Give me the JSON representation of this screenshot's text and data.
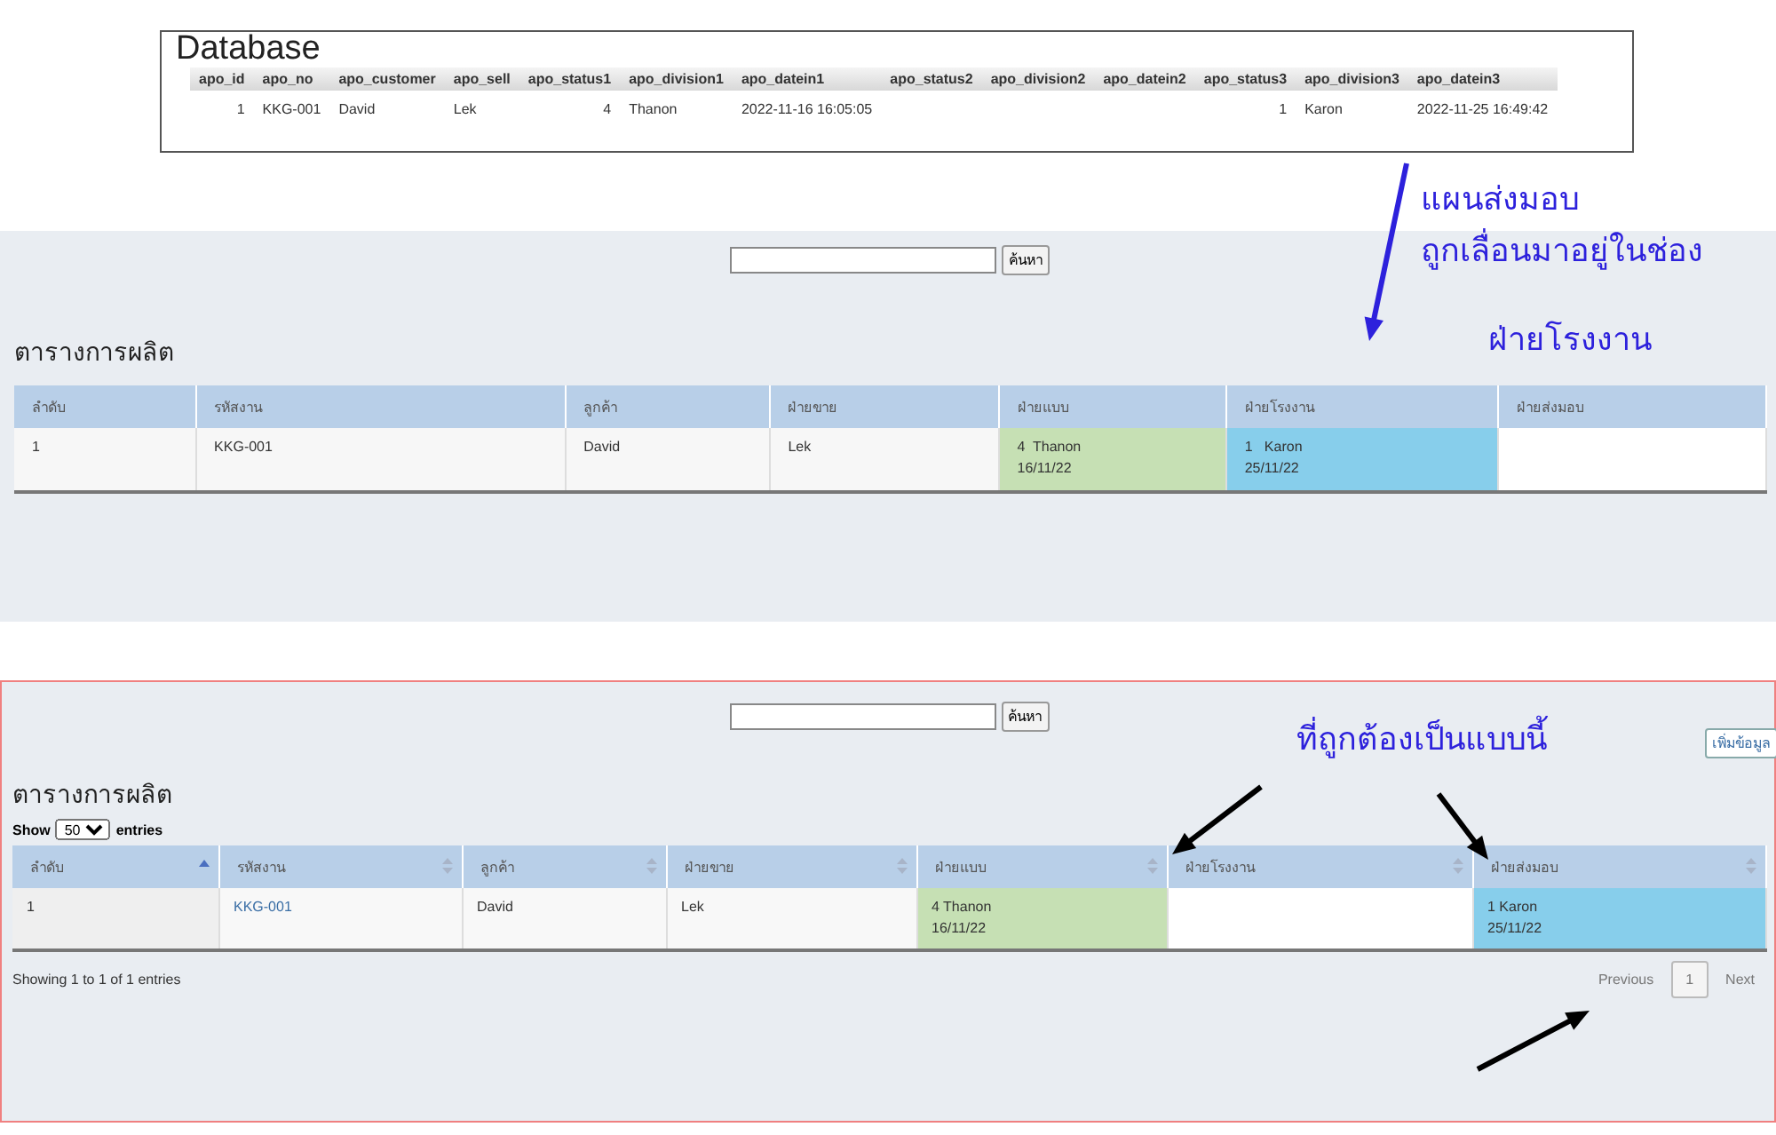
{
  "database": {
    "title": "Database",
    "columns": [
      "apo_id",
      "apo_no",
      "apo_customer",
      "apo_sell",
      "apo_status1",
      "apo_division1",
      "apo_datein1",
      "apo_status2",
      "apo_division2",
      "apo_datein2",
      "apo_status3",
      "apo_division3",
      "apo_datein3"
    ],
    "rows": [
      [
        "1",
        "KKG-001",
        "David",
        "Lek",
        "4",
        "Thanon",
        "2022-11-16 16:05:05",
        "",
        "",
        "",
        "1",
        "Karon",
        "2022-11-25 16:49:42"
      ]
    ]
  },
  "panels": [
    {
      "search_button": "ค้นหา",
      "title": "ตารางการผลิต",
      "highlighted": false,
      "columns": [
        {
          "label": "ลำดับ"
        },
        {
          "label": "รหัสงาน"
        },
        {
          "label": "ลูกค้า"
        },
        {
          "label": "ฝ่ายขาย"
        },
        {
          "label": "ฝ่ายแบบ"
        },
        {
          "label": "ฝ่ายโรงงาน"
        },
        {
          "label": "ฝ่ายส่งมอบ"
        }
      ],
      "rows": [
        [
          {
            "text": "1"
          },
          {
            "text": "KKG-001"
          },
          {
            "text": "David"
          },
          {
            "text": "Lek"
          },
          {
            "lines": [
              "4  Thanon",
              "16/11/22"
            ],
            "color": "#c6e0b4"
          },
          {
            "lines": [
              "1   Karon",
              "25/11/22"
            ],
            "color": "#87ceeb"
          },
          {}
        ]
      ]
    },
    {
      "search_button": "ค้นหา",
      "add_button": "เพิ่มข้อมูล",
      "title": "ตารางการผลิต",
      "highlighted": true,
      "length": {
        "before": "Show",
        "value": "50",
        "after": "entries"
      },
      "columns": [
        {
          "label": "ลำดับ",
          "sorted": true
        },
        {
          "label": "รหัสงาน",
          "sorted": false
        },
        {
          "label": "ลูกค้า",
          "sorted": false
        },
        {
          "label": "ฝ่ายขาย",
          "sorted": false
        },
        {
          "label": "ฝ่ายแบบ",
          "sorted": false
        },
        {
          "label": "ฝ่ายโรงงาน",
          "sorted": false
        },
        {
          "label": "ฝ่ายส่งมอบ",
          "sorted": false
        }
      ],
      "rows": [
        [
          {
            "text": "1"
          },
          {
            "text": "KKG-001",
            "kind": "link"
          },
          {
            "text": "David"
          },
          {
            "text": "Lek"
          },
          {
            "lines": [
              "4 Thanon",
              "16/11/22"
            ],
            "color": "#c6e0b4"
          },
          {},
          {
            "lines": [
              "1 Karon",
              "25/11/22"
            ],
            "color": "#87ceeb"
          }
        ]
      ],
      "info": "Showing 1 to 1 of 1 entries",
      "pagination": [
        {
          "label": "Previous",
          "kind": "prev"
        },
        {
          "label": "1",
          "kind": "page",
          "selected": true
        },
        {
          "label": "Next",
          "kind": "next"
        }
      ]
    }
  ],
  "annotations": [
    "แผนส่งมอบ",
    "ถูกเลื่อนมาอยู่ในช่อง",
    "ฝ่ายโรงงาน",
    "ที่ถูกต้องเป็นแบบนี้"
  ]
}
